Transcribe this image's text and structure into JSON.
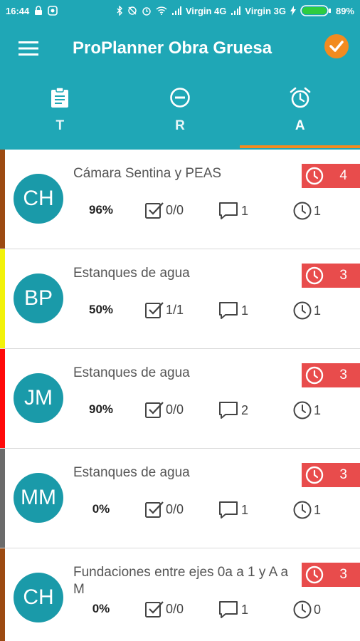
{
  "status_bar": {
    "time": "16:44",
    "carrier1": "Virgin 4G",
    "carrier2": "Virgin 3G",
    "battery": "89%"
  },
  "app": {
    "title": "ProPlanner Obra Gruesa"
  },
  "tabs": [
    {
      "label": "T",
      "icon": "clipboard-icon"
    },
    {
      "label": "R",
      "icon": "minus-circle-icon"
    },
    {
      "label": "A",
      "icon": "alarm-clock-icon",
      "active": true
    }
  ],
  "colors": {
    "primary": "#1fa7b6",
    "accent": "#f28b1f",
    "badge": "#e84c4c",
    "avatar": "#1a9aa9"
  },
  "items": [
    {
      "initials": "CH",
      "title": "Cámara Sentina y PEAS",
      "badge": "4",
      "percent": "96%",
      "tasks": "0/0",
      "comments": "1",
      "time": "1",
      "stripe": "#9c4a12"
    },
    {
      "initials": "BP",
      "title": "Estanques de agua",
      "badge": "3",
      "percent": "50%",
      "tasks": "1/1",
      "comments": "1",
      "time": "1",
      "stripe": "#f2f20a"
    },
    {
      "initials": "JM",
      "title": "Estanques de agua",
      "badge": "3",
      "percent": "90%",
      "tasks": "0/0",
      "comments": "2",
      "time": "1",
      "stripe": "#ff0a0a"
    },
    {
      "initials": "MM",
      "title": "Estanques de agua",
      "badge": "3",
      "percent": "0%",
      "tasks": "0/0",
      "comments": "1",
      "time": "1",
      "stripe": "#6b6b6b"
    },
    {
      "initials": "CH",
      "title": "Fundaciones entre ejes 0a a 1 y A a M",
      "badge": "3",
      "percent": "0%",
      "tasks": "0/0",
      "comments": "1",
      "time": "0",
      "stripe": "#9c4a12"
    }
  ]
}
